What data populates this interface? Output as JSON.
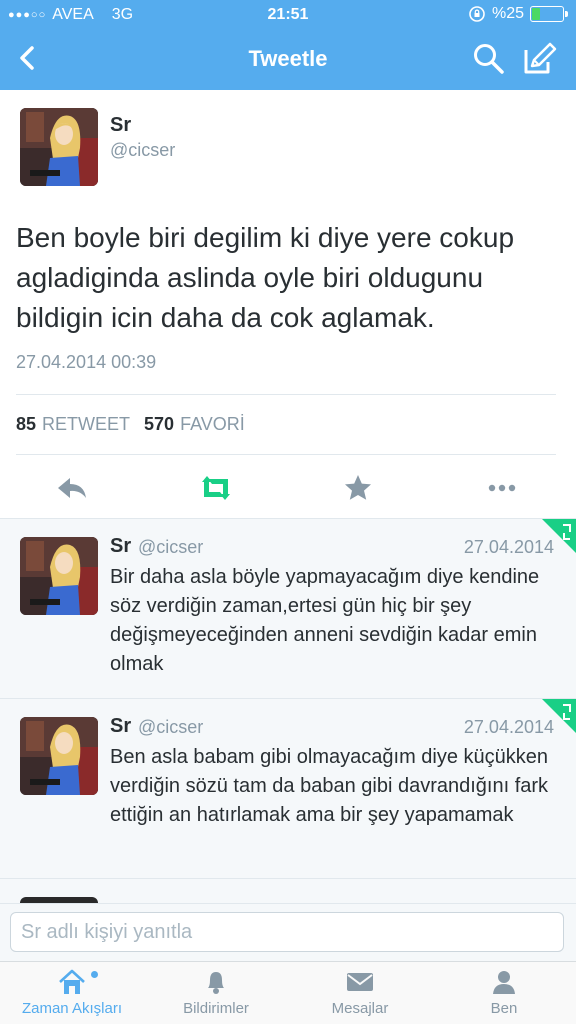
{
  "status_bar": {
    "carrier": "AVEA",
    "network": "3G",
    "time": "21:51",
    "battery": "%25",
    "battery_level": 0.25
  },
  "nav": {
    "title": "Tweetle",
    "back_icon": "chevron-left-icon",
    "search_icon": "search-icon",
    "compose_icon": "compose-icon"
  },
  "main_tweet": {
    "name": "Sr",
    "handle": "@cicser",
    "text": "Ben boyle biri degilim ki diye yere cokup agladiginda aslinda oyle biri oldugunu bildigin icin daha da cok aglamak.",
    "timestamp": "27.04.2014 00:39",
    "retweet_count": "85",
    "retweet_label": "RETWEET",
    "favorite_count": "570",
    "favorite_label": "FAVORİ",
    "actions": [
      "reply-icon",
      "retweet-icon",
      "favorite-icon",
      "more-icon"
    ]
  },
  "replies": [
    {
      "name": "Sr",
      "handle": "@cicser",
      "date": "27.04.2014",
      "text": "Bir daha asla böyle yapmayacağım diye kendine söz verdiğin zaman,ertesi gün hiç bir şey değişmeyeceğinden anneni sevdiğin kadar emin olmak"
    },
    {
      "name": "Sr",
      "handle": "@cicser",
      "date": "27.04.2014",
      "text": "Ben asla babam gibi olmayacağım diye küçükken verdiğin sözü tam da baban gibi davrandığını fark ettiğin an hatırlamak ama bir şey yapamamak"
    }
  ],
  "reply_box": {
    "placeholder": "Sr adlı kişiyi yanıtla"
  },
  "tabs": [
    {
      "label": "Zaman Akışları",
      "icon": "home-icon",
      "active": true
    },
    {
      "label": "Bildirimler",
      "icon": "bell-icon",
      "active": false
    },
    {
      "label": "Mesajlar",
      "icon": "envelope-icon",
      "active": false
    },
    {
      "label": "Ben",
      "icon": "person-icon",
      "active": false
    }
  ],
  "colors": {
    "brand": "#55acee",
    "retweet_green": "#19cf86",
    "text": "#292f33",
    "muted": "#8899a6"
  }
}
